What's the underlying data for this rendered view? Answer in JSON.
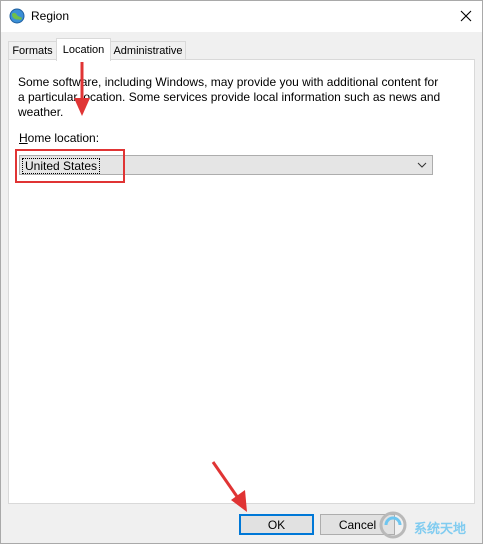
{
  "window": {
    "title": "Region",
    "close_glyph": "✕"
  },
  "tabs": [
    {
      "label": "Formats",
      "active": false
    },
    {
      "label": "Location",
      "active": true
    },
    {
      "label": "Administrative",
      "active": false
    }
  ],
  "location": {
    "description": "Some software, including Windows, may provide you with additional content for a particular location. Some services provide local information such as news and weather.",
    "home_label_accel": "H",
    "home_label_rest": "ome location:",
    "selected_value": "United States"
  },
  "buttons": {
    "ok": "OK",
    "cancel": "Cancel"
  },
  "watermark": "系统天地",
  "colors": {
    "annotation": "#e03434",
    "default_button_border": "#0078d7"
  }
}
